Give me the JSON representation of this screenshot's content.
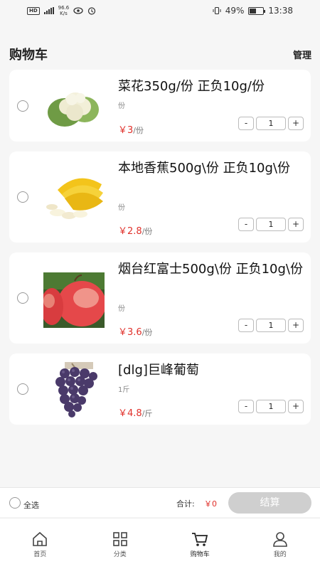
{
  "status_bar": {
    "left_hd": "HD",
    "left_net_speed": "96.6",
    "left_net_unit": "K/s",
    "right_battery": "49%",
    "right_time": "13:38"
  },
  "header": {
    "title": "购物车",
    "manage_label": "管理"
  },
  "items": [
    {
      "title": "菜花350g/份 正负10g/份",
      "spec": "份",
      "price": "￥3",
      "unit": "/份",
      "qty": "1",
      "image": "cauliflower"
    },
    {
      "title": "本地香蕉500g\\份 正负10g\\份",
      "spec": "份",
      "price": "￥2.8",
      "unit": "/份",
      "qty": "1",
      "image": "banana"
    },
    {
      "title": "烟台红富士500g\\份 正负10g\\份",
      "spec": "份",
      "price": "￥3.6",
      "unit": "/份",
      "qty": "1",
      "image": "apple"
    },
    {
      "title": "[dlg]巨峰葡萄",
      "spec": "1斤",
      "price": "￥4.8",
      "unit": "/斤",
      "qty": "1",
      "image": "grape"
    }
  ],
  "stepper": {
    "minus": "-",
    "plus": "+"
  },
  "checkout": {
    "select_all": "全选",
    "total_label": "合计:",
    "total_value": "￥0",
    "settle_button": "结算"
  },
  "tabs": [
    {
      "label": "首页",
      "icon": "home-icon"
    },
    {
      "label": "分类",
      "icon": "grid-icon"
    },
    {
      "label": "购物车",
      "icon": "cart-icon"
    },
    {
      "label": "我的",
      "icon": "user-icon"
    }
  ],
  "colors": {
    "price": "#e0302a",
    "settle_disabled": "#cfcfcf"
  }
}
